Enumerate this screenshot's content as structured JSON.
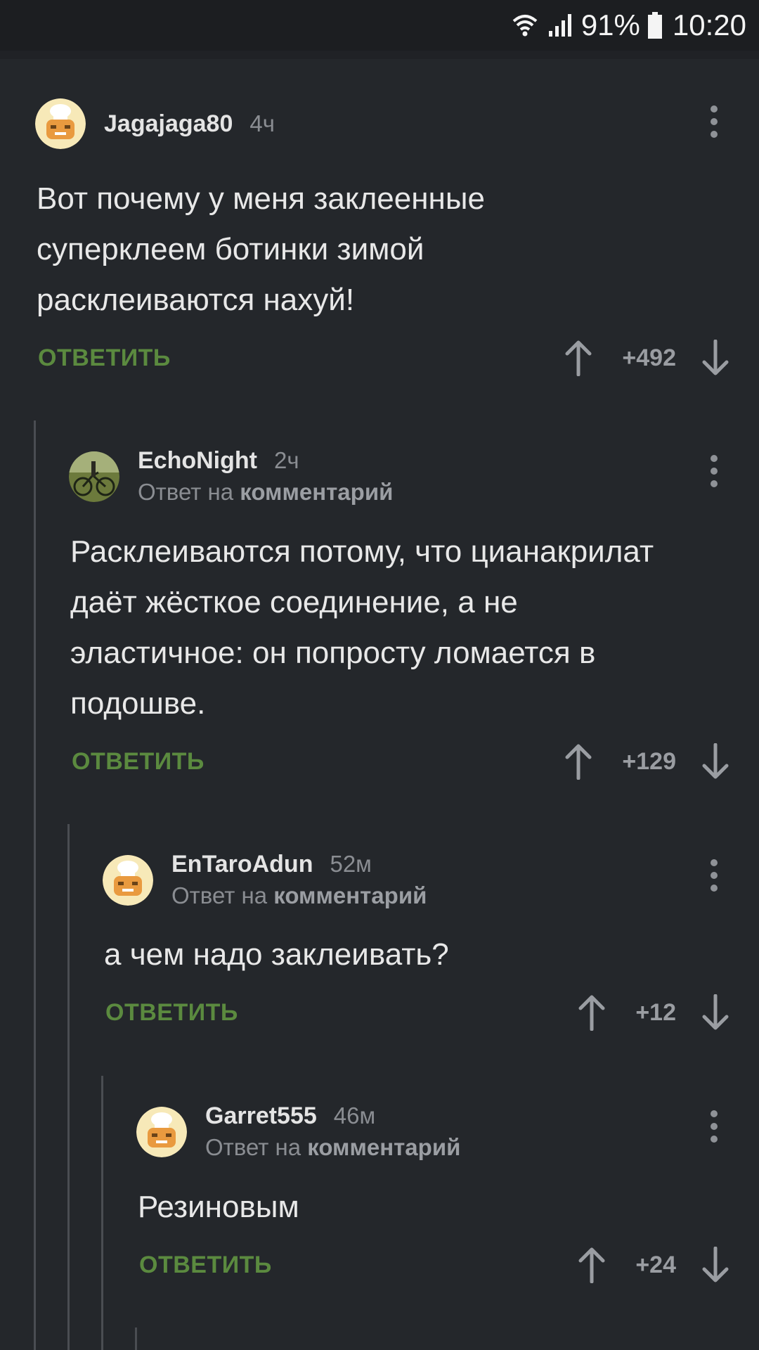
{
  "status_bar": {
    "battery": "91%",
    "time": "10:20"
  },
  "reply_action_label": "ОТВЕТИТЬ",
  "reply_to_prefix": "Ответ на",
  "reply_to_target": "комментарий",
  "comments": [
    {
      "username": "Jagajaga80",
      "time": "4ч",
      "text_lines": [
        "Вот почему у меня заклеенные",
        "суперклеем ботинки зимой",
        "расклеиваются нахуй!"
      ],
      "score": "+492",
      "avatar": "chef-avatar"
    },
    {
      "username": "EchoNight",
      "time": "2ч",
      "text_lines": [
        "Расклеиваются потому, что цианакрилат",
        "даёт жёсткое соединение, а не",
        "эластичное: он попросту ломается в",
        "подошве."
      ],
      "score": "+129",
      "avatar": "bicycle-photo-avatar"
    },
    {
      "username": "EnTaroAdun",
      "time": "52м",
      "text_lines": [
        "а чем надо заклеивать?"
      ],
      "score": "+12",
      "avatar": "chef-avatar"
    },
    {
      "username": "Garret555",
      "time": "46м",
      "text_lines": [
        "Резиновым"
      ],
      "score": "+24",
      "avatar": "chef-avatar"
    }
  ],
  "colors": {
    "background": "#24272b",
    "reply_green": "#5b8a3f",
    "muted_text": "#8a8d92",
    "thread_line": "#4a4d52"
  }
}
